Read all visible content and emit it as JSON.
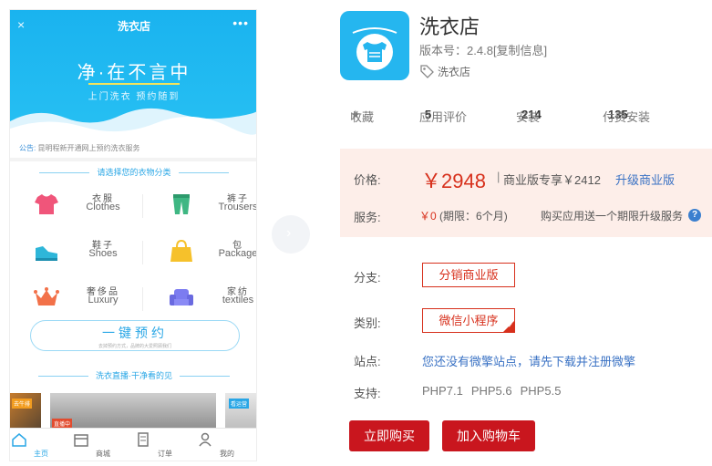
{
  "phone": {
    "title": "洗衣店",
    "close_icon": "×",
    "more_icon": "•••",
    "slogan": "净·在不言中",
    "subslogan": "上门洗衣  预约随到",
    "notice_label": "公告:",
    "notice_text": "昆明程新开通网上预约洗衣服务",
    "category_heading": "请选择您的衣物分类",
    "categories": [
      {
        "cn": "衣服",
        "en": "Clothes",
        "icon": "tshirt-icon",
        "color": "#f0557a"
      },
      {
        "cn": "裤子",
        "en": "Trousers",
        "icon": "trousers-icon",
        "color": "#3fb783"
      },
      {
        "cn": "鞋子",
        "en": "Shoes",
        "icon": "shoes-icon",
        "color": "#2eb6d9"
      },
      {
        "cn": "包",
        "en": "Package",
        "icon": "bag-icon",
        "color": "#f6c12b"
      },
      {
        "cn": "奢侈品",
        "en": "Luxury",
        "icon": "crown-icon",
        "color": "#f27149"
      },
      {
        "cn": "家纺",
        "en": "textiles",
        "icon": "sofa-icon",
        "color": "#7c7cf0"
      }
    ],
    "book_label": "一键预约",
    "book_sub": "去掉预约方式，品牌的大爱照顾我们",
    "live_heading": "洗衣直播·干净看的见",
    "live_tags": [
      "去牛排",
      "直播中",
      "看运营"
    ],
    "tabs": [
      {
        "label": "主页",
        "icon": "home-icon"
      },
      {
        "label": "商城",
        "icon": "store-icon"
      },
      {
        "label": "订单",
        "icon": "order-icon"
      },
      {
        "label": "我的",
        "icon": "user-icon"
      }
    ]
  },
  "product": {
    "title": "洗衣店",
    "version_label": "版本号：",
    "version": "2.4.8",
    "copy_info": "[复制信息]",
    "tag": "洗衣店",
    "logo_icon": "laundry-tshirt-icon",
    "brand_color": "#25b6ef"
  },
  "stats": {
    "favorite_label": "收藏",
    "rating_label": "应用评价",
    "rating": "5",
    "install_label": "安装",
    "installs": "214",
    "paid_install_label": "付费安装",
    "paid_installs": "135"
  },
  "pricing": {
    "price_label": "价格:",
    "price": "￥2948",
    "separator": "|",
    "business_price": "商业版专享￥2412",
    "upgrade_link": "升级商业版",
    "service_label": "服务:",
    "service_price": "￥0",
    "service_period": "(期限：6个月)",
    "service_note": "购买应用送一个期限升级服务",
    "help_icon": "?",
    "accent_color": "#d7301c"
  },
  "options": {
    "branch_label": "分支:",
    "branch_value": "分销商业版",
    "category_label": "类别:",
    "category_value": "微信小程序",
    "site_label": "站点:",
    "site_value": "您还没有微擎站点，请先下载并注册微擎",
    "support_label": "支持:",
    "support_values": [
      "PHP7.1",
      "PHP5.6",
      "PHP5.5"
    ]
  },
  "actions": {
    "buy_label": "立即购买",
    "cart_label": "加入购物车",
    "button_color": "#c9161e"
  }
}
